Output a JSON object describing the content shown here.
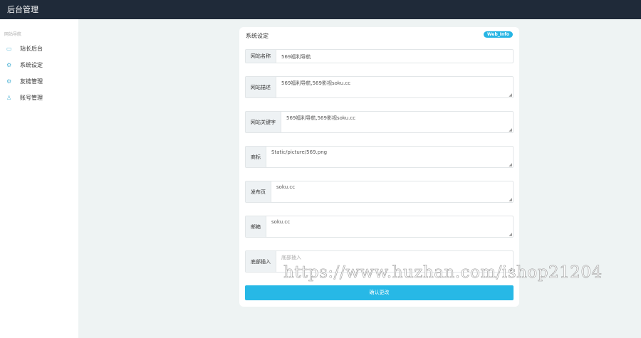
{
  "header": {
    "title": "后台管理"
  },
  "sidebar": {
    "section_title": "网站导航",
    "items": [
      {
        "label": "站长后台",
        "icon": "monitor-icon"
      },
      {
        "label": "系统设定",
        "icon": "gear-icon"
      },
      {
        "label": "友链管理",
        "icon": "gear-icon"
      },
      {
        "label": "账号管理",
        "icon": "user-icon"
      }
    ]
  },
  "card": {
    "title": "系统设定",
    "badge": "Web_Info",
    "fields": [
      {
        "label": "网站名称",
        "value": "569福利导航"
      },
      {
        "label": "网站描述",
        "value": "569福利导航,569影视soku.cc"
      },
      {
        "label": "网站关键字",
        "value": "569福利导航,569影视soku.cc"
      },
      {
        "label": "商标",
        "value": "Static/picture/569.png"
      },
      {
        "label": "发布页",
        "value": "soku.cc"
      },
      {
        "label": "邮箱",
        "value": "soku.cc"
      },
      {
        "label": "底部插入",
        "placeholder": "底部插入"
      }
    ],
    "submit": "确认更改"
  },
  "watermark": "https://www.huzhan.com/ishop21204",
  "colors": {
    "header": "#1f2a39",
    "accent": "#27b8e6"
  }
}
